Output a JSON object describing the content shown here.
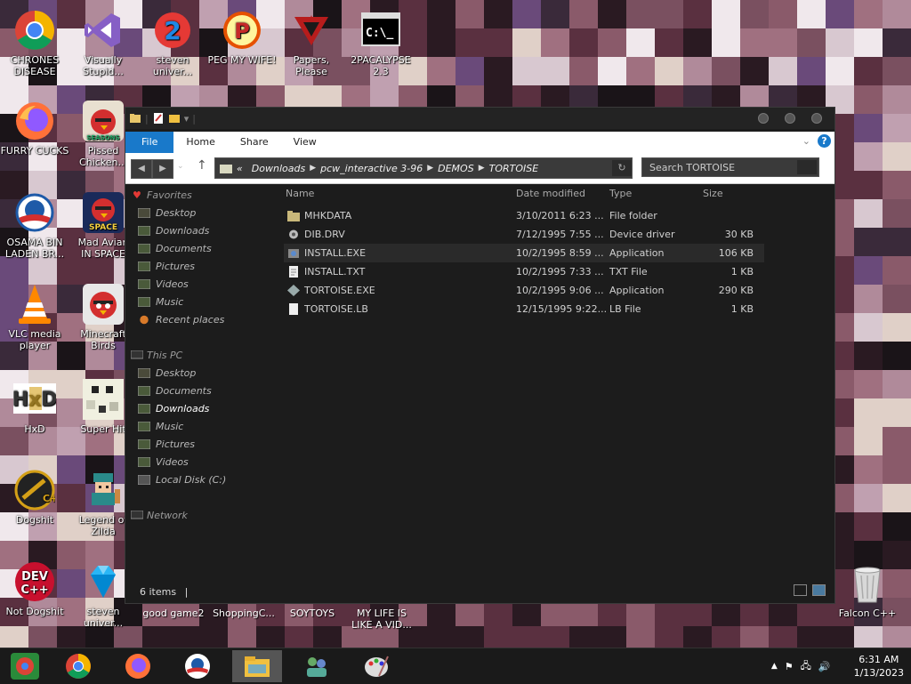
{
  "desktop": {
    "icons": [
      {
        "name": "chrome-shortcut",
        "label_line1": "CHRONES",
        "label_line2": "DISEASE",
        "icon": "chrome-icon"
      },
      {
        "name": "visual-studio-shortcut",
        "label_line1": "Visually",
        "label_line2": "Stupid...",
        "icon": "visual-studio-icon"
      },
      {
        "name": "steven-universe-shortcut-1",
        "label_line1": "steven",
        "label_line2": "univer...",
        "icon": "steven-universe-icon"
      },
      {
        "name": "peg-shortcut",
        "label_line1": "PEG MY WIFE!",
        "label_line2": "",
        "icon": "peg-icon"
      },
      {
        "name": "papers-please-shortcut",
        "label_line1": "Papers,",
        "label_line2": "Please",
        "icon": "papers-please-icon"
      },
      {
        "name": "2pacalypse-shortcut",
        "label_line1": "2PACALYPSE",
        "label_line2": "2.3",
        "icon": "terminal-icon"
      },
      {
        "name": "firefox-shortcut",
        "label_line1": "FURRY CUCKS",
        "label_line2": "",
        "icon": "firefox-icon"
      },
      {
        "name": "angry-birds-seasons-shortcut",
        "label_line1": "Pissed",
        "label_line2": "Chicken...",
        "icon": "angry-birds-seasons-icon"
      },
      {
        "name": "obama-shortcut",
        "label_line1": "OSAMA BIN",
        "label_line2": "LADEN BR...",
        "icon": "obama-logo-icon"
      },
      {
        "name": "angry-birds-space-shortcut",
        "label_line1": "Mad Avian",
        "label_line2": "IN SPACE",
        "icon": "angry-birds-space-icon"
      },
      {
        "name": "vlc-shortcut",
        "label_line1": "VLC media",
        "label_line2": "player",
        "icon": "vlc-icon"
      },
      {
        "name": "minecraft-birds-shortcut",
        "label_line1": "Minecraft",
        "label_line2": "Birds",
        "icon": "angry-bird-icon"
      },
      {
        "name": "hxd-shortcut",
        "label_line1": "HxD",
        "label_line2": "",
        "icon": "hxd-icon"
      },
      {
        "name": "super-hit-shortcut",
        "label_line1": "Super Hit",
        "label_line2": "",
        "icon": "pixel-art-icon"
      },
      {
        "name": "dogshit-shortcut",
        "label_line1": "Dogshit",
        "label_line2": "",
        "icon": "cpp-icon"
      },
      {
        "name": "legend-of-zilda-shortcut",
        "label_line1": "Legend of",
        "label_line2": "Zilda",
        "icon": "pixel-hero-icon"
      },
      {
        "name": "devcpp-shortcut",
        "label_line1": "Not Dogshit",
        "label_line2": "",
        "icon": "devcpp-icon"
      },
      {
        "name": "steven-universe-shortcut-2",
        "label_line1": "steven",
        "label_line2": "univer...",
        "icon": "gem-icon"
      },
      {
        "name": "recycle-bin",
        "label_line1": "Falcon C++",
        "label_line2": "",
        "icon": "recycle-bin-icon"
      }
    ],
    "bottom_labels": [
      {
        "line1": "good game2",
        "line2": ""
      },
      {
        "line1": "ShoppingC...",
        "line2": ""
      },
      {
        "line1": "SOYTOYS",
        "line2": ""
      },
      {
        "line1": "MY LIFE IS",
        "line2": "LIKE A VID..."
      }
    ]
  },
  "explorer": {
    "ribbon_tabs": [
      "File",
      "Home",
      "Share",
      "View"
    ],
    "help_label": "?",
    "address": {
      "prefix": "«",
      "crumbs": [
        "Downloads",
        "pcw_interactive 3-96",
        "DEMOS",
        "TORTOISE"
      ]
    },
    "search_placeholder": "Search TORTOISE",
    "sidebar": {
      "favorites_header": "Favorites",
      "favorites": [
        "Desktop",
        "Downloads",
        "Documents",
        "Pictures",
        "Videos",
        "Music",
        "Recent places"
      ],
      "thispc_header": "This PC",
      "thispc": [
        "Desktop",
        "Documents",
        "Downloads",
        "Music",
        "Pictures",
        "Videos",
        "Local Disk (C:)"
      ],
      "network_header": "Network"
    },
    "columns": {
      "name": "Name",
      "date": "Date modified",
      "type": "Type",
      "size": "Size"
    },
    "files": [
      {
        "name": "MHKDATA",
        "date": "3/10/2011 6:23 ...",
        "type": "File folder",
        "size": "",
        "icon": "folder-icon"
      },
      {
        "name": "DIB.DRV",
        "date": "7/12/1995 7:55 ...",
        "type": "Device driver",
        "size": "30 KB",
        "icon": "gear-file-icon"
      },
      {
        "name": "INSTALL.EXE",
        "date": "10/2/1995 8:59 ...",
        "type": "Application",
        "size": "106 KB",
        "icon": "installer-icon"
      },
      {
        "name": "INSTALL.TXT",
        "date": "10/2/1995 7:33 ...",
        "type": "TXT File",
        "size": "1 KB",
        "icon": "text-file-icon"
      },
      {
        "name": "TORTOISE.EXE",
        "date": "10/2/1995 9:06 ...",
        "type": "Application",
        "size": "290 KB",
        "icon": "exe-icon"
      },
      {
        "name": "TORTOISE.LB",
        "date": "12/15/1995 9:22...",
        "type": "LB File",
        "size": "1 KB",
        "icon": "blank-file-icon"
      }
    ],
    "status": "6 items"
  },
  "taskbar": {
    "items": [
      "start-button",
      "chrome",
      "firefox",
      "obama",
      "file-explorer",
      "network-app",
      "paint"
    ],
    "clock": {
      "time": "6:31 AM",
      "date": "1/13/2023"
    }
  },
  "colors": {
    "accent": "#1979ca",
    "window_bg": "#1c1c1c",
    "taskbar_bg": "#1a1a1a"
  }
}
